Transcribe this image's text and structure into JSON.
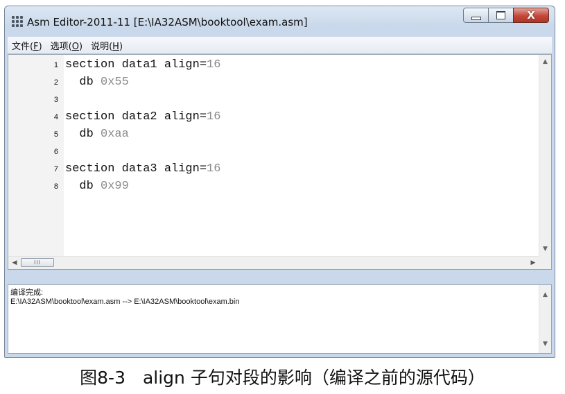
{
  "window": {
    "title": "Asm Editor-2011-11 [E:\\IA32ASM\\booktool\\exam.asm]",
    "close_glyph": "X"
  },
  "menu": [
    {
      "label": "文件",
      "accel": "F"
    },
    {
      "label": "选项",
      "accel": "O"
    },
    {
      "label": "说明",
      "accel": "H"
    }
  ],
  "editor": {
    "lines": [
      {
        "num": "1",
        "code": "section data1 align=",
        "value": "16"
      },
      {
        "num": "2",
        "code": "  db ",
        "value": "0x55"
      },
      {
        "num": "3",
        "code": "",
        "value": ""
      },
      {
        "num": "4",
        "code": "section data2 align=",
        "value": "16"
      },
      {
        "num": "5",
        "code": "  db ",
        "value": "0xaa"
      },
      {
        "num": "6",
        "code": "",
        "value": ""
      },
      {
        "num": "7",
        "code": "section data3 align=",
        "value": "16"
      },
      {
        "num": "8",
        "code": "  db ",
        "value": "0x99"
      }
    ]
  },
  "output": {
    "status": "编译完成:",
    "path": "E:\\IA32ASM\\booktool\\exam.asm --> E:\\IA32ASM\\booktool\\exam.bin"
  },
  "caption": "图8-3　align 子句对段的影响（编译之前的源代码）",
  "icons": [
    "app-icon",
    "minimize-icon",
    "maximize-icon",
    "close-icon",
    "scroll-up-icon",
    "scroll-down-icon",
    "scroll-left-icon",
    "scroll-right-icon"
  ]
}
